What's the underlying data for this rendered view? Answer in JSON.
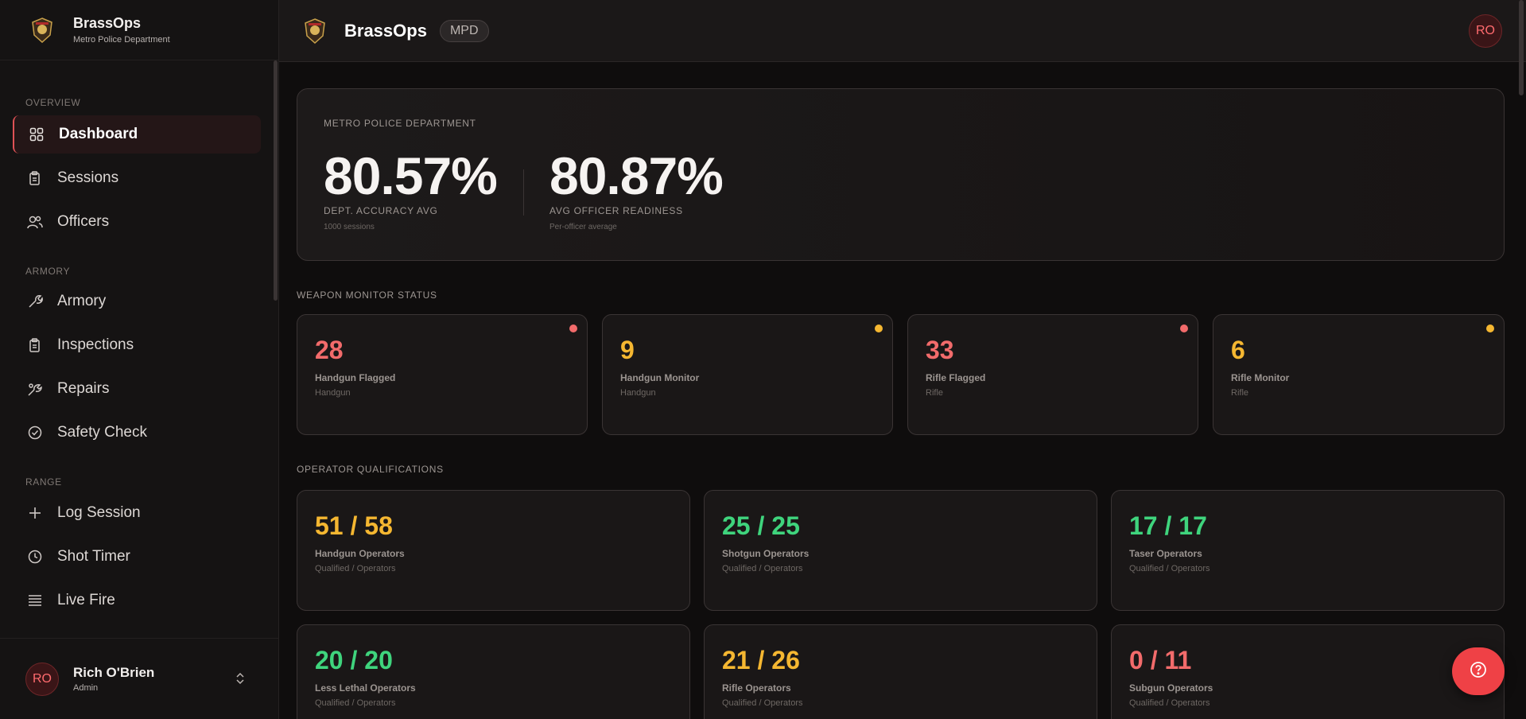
{
  "brand": {
    "name": "BrassOps",
    "department": "Metro Police Department"
  },
  "header": {
    "name": "BrassOps",
    "badge": "MPD",
    "avatar": "RO"
  },
  "sidebar": {
    "sections": [
      "OVERVIEW",
      "ARMORY",
      "RANGE"
    ],
    "items": [
      {
        "label": "Dashboard",
        "icon": "grid-icon",
        "active": true
      },
      {
        "label": "Sessions",
        "icon": "clipboard-icon"
      },
      {
        "label": "Officers",
        "icon": "users-icon"
      },
      {
        "label": "Armory",
        "icon": "wrench-icon"
      },
      {
        "label": "Inspections",
        "icon": "clipboard-check-icon"
      },
      {
        "label": "Repairs",
        "icon": "tools-icon"
      },
      {
        "label": "Safety Check",
        "icon": "check-circle-icon"
      },
      {
        "label": "Log Session",
        "icon": "plus-icon"
      },
      {
        "label": "Shot Timer",
        "icon": "clock-icon"
      },
      {
        "label": "Live Fire",
        "icon": "list-icon"
      }
    ]
  },
  "user": {
    "initials": "RO",
    "name": "Rich O'Brien",
    "role": "Admin"
  },
  "hero": {
    "kicker": "METRO POLICE DEPARTMENT",
    "accuracy": {
      "value": "80.57%",
      "label": "DEPT. ACCURACY AVG",
      "sub": "1000 sessions"
    },
    "readiness": {
      "value": "80.87%",
      "label": "AVG OFFICER READINESS",
      "sub": "Per-officer average"
    }
  },
  "weapon_monitor": {
    "title": "WEAPON MONITOR STATUS",
    "cards": [
      {
        "value": "28",
        "name": "Handgun Flagged",
        "sub": "Handgun",
        "color": "#f26b6b"
      },
      {
        "value": "9",
        "name": "Handgun Monitor",
        "sub": "Handgun",
        "color": "#f5b731"
      },
      {
        "value": "33",
        "name": "Rifle Flagged",
        "sub": "Rifle",
        "color": "#f26b6b"
      },
      {
        "value": "6",
        "name": "Rifle Monitor",
        "sub": "Rifle",
        "color": "#f5b731"
      }
    ]
  },
  "qualifications": {
    "title": "OPERATOR QUALIFICATIONS",
    "cards": [
      {
        "value": "51 / 58",
        "name": "Handgun Operators",
        "sub": "Qualified / Operators",
        "color": "#f5b731"
      },
      {
        "value": "25 / 25",
        "name": "Shotgun Operators",
        "sub": "Qualified / Operators",
        "color": "#3fd47d"
      },
      {
        "value": "17 / 17",
        "name": "Taser Operators",
        "sub": "Qualified / Operators",
        "color": "#3fd47d"
      },
      {
        "value": "20 / 20",
        "name": "Less Lethal Operators",
        "sub": "Qualified / Operators",
        "color": "#3fd47d"
      },
      {
        "value": "21 / 26",
        "name": "Rifle Operators",
        "sub": "Qualified / Operators",
        "color": "#f5b731"
      },
      {
        "value": "0 / 11",
        "name": "Subgun Operators",
        "sub": "Qualified / Operators",
        "color": "#f26b6b"
      }
    ]
  }
}
